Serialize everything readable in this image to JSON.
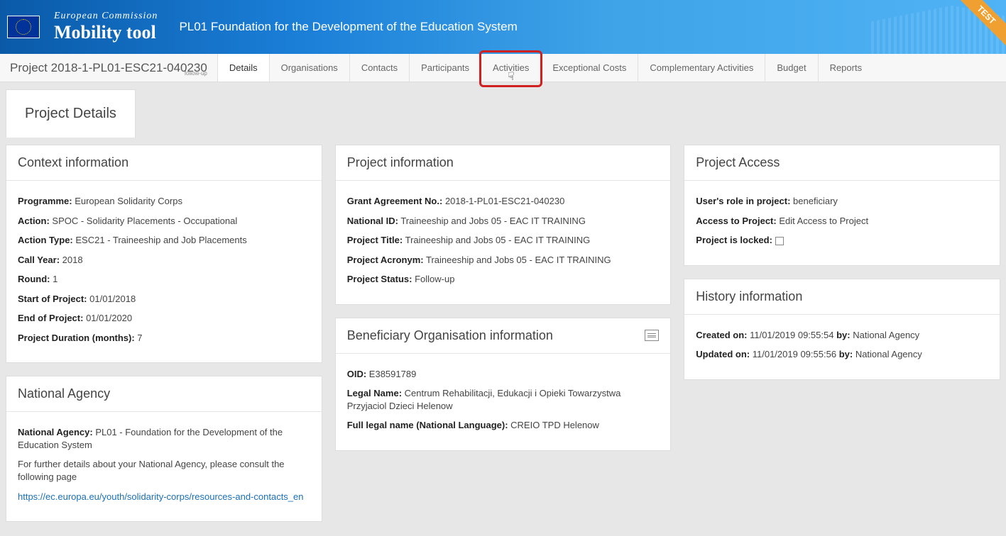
{
  "header": {
    "ec_label": "European Commission",
    "tool_label": "Mobility tool",
    "org_title": "PL01 Foundation for the Development of the Education System",
    "test_ribbon": "TEST"
  },
  "navbar": {
    "project_code": "Project 2018-1-PL01-ESC21-040230",
    "project_sub": "follow-up",
    "tabs": [
      {
        "id": "details",
        "label": "Details",
        "active": true
      },
      {
        "id": "organisations",
        "label": "Organisations",
        "active": false
      },
      {
        "id": "contacts",
        "label": "Contacts",
        "active": false
      },
      {
        "id": "participants",
        "label": "Participants",
        "active": false
      },
      {
        "id": "activities",
        "label": "Activities",
        "active": false,
        "highlighted": true
      },
      {
        "id": "exceptional",
        "label": "Exceptional Costs",
        "active": false
      },
      {
        "id": "complementary",
        "label": "Complementary Activities",
        "active": false
      },
      {
        "id": "budget",
        "label": "Budget",
        "active": false
      },
      {
        "id": "reports",
        "label": "Reports",
        "active": false
      }
    ]
  },
  "subtab": {
    "label": "Project Details"
  },
  "context": {
    "heading": "Context information",
    "programme_label": "Programme:",
    "programme_value": "European Solidarity Corps",
    "action_label": "Action:",
    "action_value": "SPOC - Solidarity Placements - Occupational",
    "action_type_label": "Action Type:",
    "action_type_value": "ESC21 - Traineeship and Job Placements",
    "call_year_label": "Call Year:",
    "call_year_value": "2018",
    "round_label": "Round:",
    "round_value": "1",
    "start_label": "Start of Project:",
    "start_value": "01/01/2018",
    "end_label": "End of Project:",
    "end_value": "01/01/2020",
    "duration_label": "Project Duration (months):",
    "duration_value": "7"
  },
  "national_agency": {
    "heading": "National Agency",
    "na_label": "National Agency:",
    "na_value": "PL01 - Foundation for the Development of the Education System",
    "further_text": "For further details about your National Agency, please consult the following page",
    "link_text": "https://ec.europa.eu/youth/solidarity-corps/resources-and-contacts_en"
  },
  "project_info": {
    "heading": "Project information",
    "grant_label": "Grant Agreement No.:",
    "grant_value": "2018-1-PL01-ESC21-040230",
    "national_id_label": "National ID:",
    "national_id_value": "Traineeship and Jobs 05 - EAC IT TRAINING",
    "title_label": "Project Title:",
    "title_value": "Traineeship and Jobs 05 - EAC IT TRAINING",
    "acronym_label": "Project Acronym:",
    "acronym_value": "Traineeship and Jobs 05 - EAC IT TRAINING",
    "status_label": "Project Status:",
    "status_value": "Follow-up"
  },
  "beneficiary": {
    "heading": "Beneficiary Organisation information",
    "oid_label": "OID:",
    "oid_value": "E38591789",
    "legal_label": "Legal Name:",
    "legal_value": "Centrum Rehabilitacji, Edukacji i Opieki Towarzystwa Przyjaciol Dzieci Helenow",
    "full_label": "Full legal name (National Language):",
    "full_value": "CREIO TPD Helenow"
  },
  "access": {
    "heading": "Project Access",
    "role_label": "User's role in project:",
    "role_value": "beneficiary",
    "access_label": "Access to Project:",
    "access_value": "Edit Access to Project",
    "locked_label": "Project is locked:"
  },
  "history": {
    "heading": "History information",
    "created_label": "Created on:",
    "created_time": "11/01/2019 09:55:54",
    "by_label": "by:",
    "created_by": "National Agency",
    "updated_label": "Updated on:",
    "updated_time": "11/01/2019 09:55:56",
    "updated_by": "National Agency"
  }
}
